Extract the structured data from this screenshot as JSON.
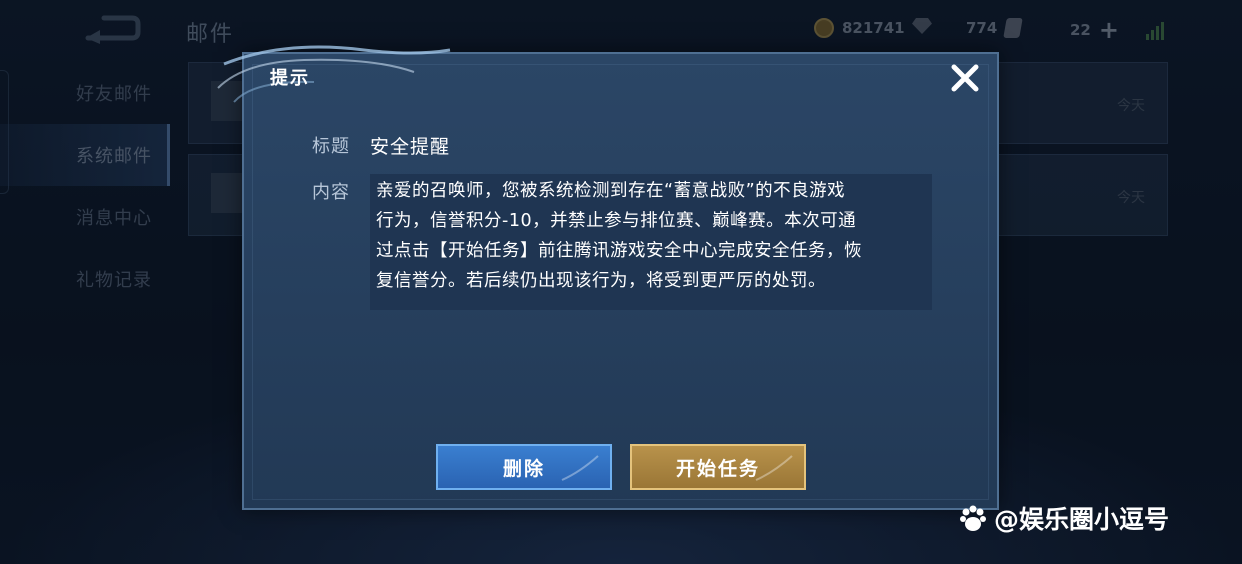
{
  "header": {
    "page_title": "邮件",
    "gold": "821741",
    "diamonds": "774",
    "tickets": "22"
  },
  "sidebar": {
    "items": [
      {
        "label": "好友邮件"
      },
      {
        "label": "系统邮件"
      },
      {
        "label": "消息中心"
      },
      {
        "label": "礼物记录"
      }
    ],
    "active_index": 1
  },
  "mail_list": [
    {
      "date": "今天"
    },
    {
      "date": "今天"
    }
  ],
  "dialog": {
    "title": "提示",
    "subject_label": "标题",
    "subject": "安全提醒",
    "content_label": "内容",
    "content_lines": [
      "亲爱的召唤师，您被系统检测到存在“蓄意战败”的不良游戏",
      "行为，信誉积分-10，并禁止参与排位赛、巅峰赛。本次可通",
      "过点击【开始任务】前往腾讯游戏安全中心完成安全任务，恢",
      "复信誉分。若后续仍出现该行为，将受到更严厉的处罚。"
    ],
    "delete_label": "删除",
    "start_label": "开始任务"
  },
  "watermark": "@娱乐圈小逗号",
  "icons": [
    "back-icon",
    "coin-icon",
    "gem-icon",
    "ticket-icon",
    "plus-icon",
    "signal-icon",
    "envelope-icon",
    "close-icon",
    "paw-icon"
  ],
  "colors": {
    "delete_button": "#2f6cbf",
    "start_button": "#a88340",
    "dialog_bg": "#28425f"
  }
}
